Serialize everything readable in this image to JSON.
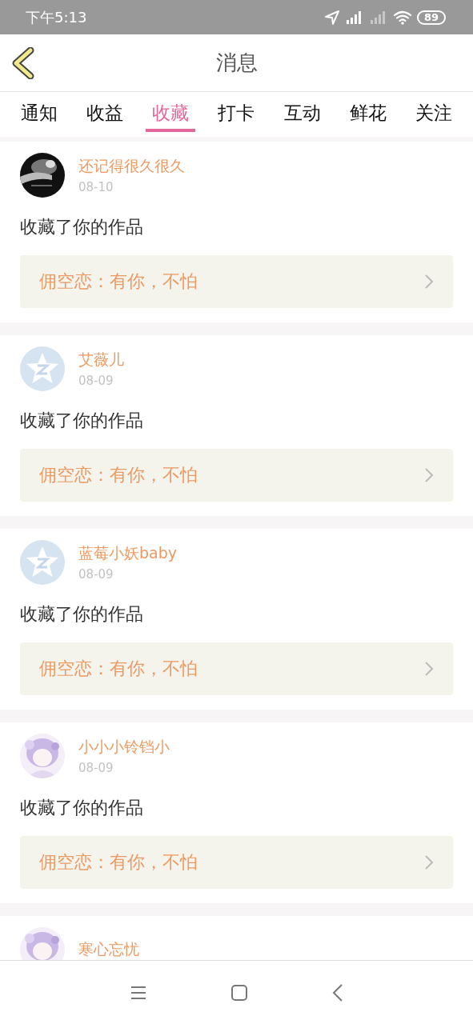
{
  "status_bar": {
    "time": "下午5:13",
    "battery": "89"
  },
  "header": {
    "title": "消息"
  },
  "tabs": [
    {
      "label": "通知",
      "selected": false
    },
    {
      "label": "收益",
      "selected": false
    },
    {
      "label": "收藏",
      "selected": true
    },
    {
      "label": "打卡",
      "selected": false
    },
    {
      "label": "互动",
      "selected": false
    },
    {
      "label": "鲜花",
      "selected": false
    },
    {
      "label": "关注",
      "selected": false
    }
  ],
  "messages": [
    {
      "user": "还记得很久很久",
      "date": "08-10",
      "action": "收藏了你的作品",
      "work": "佣空恋：有你，不怕"
    },
    {
      "user": "艾薇儿",
      "avatar": {
        "kind": "default"
      },
      "date": "08-09",
      "action": "收藏了你的作品",
      "work": "佣空恋：有你，不怕"
    },
    {
      "user": "蓝莓小妖baby",
      "avatar": {
        "kind": "default"
      },
      "date": "08-09",
      "action": "收藏了你的作品",
      "work": "佣空恋：有你，不怕"
    },
    {
      "user": "小小小铃铛小",
      "date": "08-09",
      "action": "收藏了你的作品",
      "work": "佣空恋：有你，不怕"
    },
    {
      "user": "寒心忘忧"
    }
  ]
}
